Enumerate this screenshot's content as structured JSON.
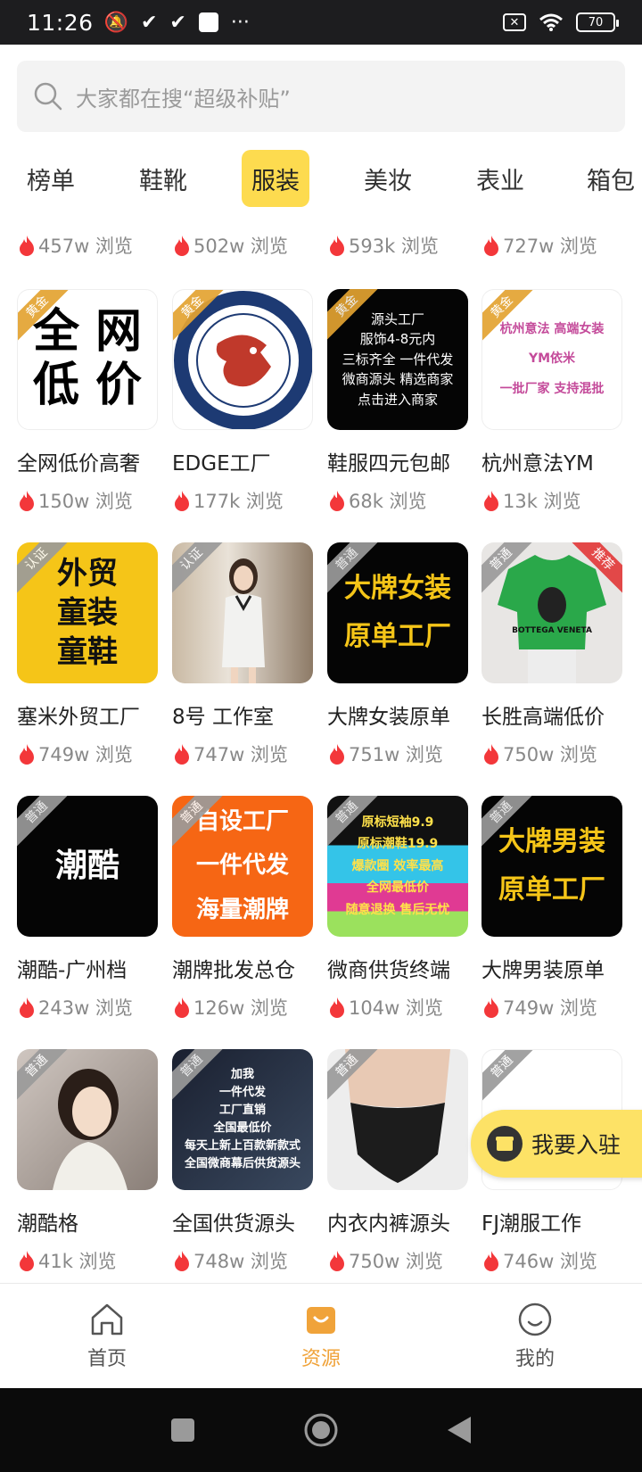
{
  "status": {
    "time": "11:26",
    "dots": "···",
    "battery": "70"
  },
  "search": {
    "placeholder": "大家都在搜“超级补贴”"
  },
  "tabs": [
    {
      "label": "榜单"
    },
    {
      "label": "鞋靴"
    },
    {
      "label": "服装"
    },
    {
      "label": "美妆"
    },
    {
      "label": "表业"
    },
    {
      "label": "箱包"
    }
  ],
  "active_tab": "服装",
  "partial_row": [
    "457w 浏览",
    "502w 浏览",
    "593k 浏览",
    "727w 浏览"
  ],
  "cards": [
    {
      "name": "全网低价高奢",
      "views": "150w 浏览",
      "badge": "黄金",
      "thumb_text": "全 网\n低 价"
    },
    {
      "name": "EDGE工厂",
      "views": "177k 浏览",
      "badge": "黄金",
      "thumb_text": "GUIMEIGONGZHU DIHU MOGUIXIONGDI"
    },
    {
      "name": "鞋服四元包邮",
      "views": "68k 浏览",
      "badge": "黄金",
      "thumb_text": "源头工厂\n服饰4-8元内\n三标齐全 一件代发\n微商源头 精选商家\n点击进入商家"
    },
    {
      "name": "杭州意法YM",
      "views": "13k 浏览",
      "badge": "黄金",
      "thumb_text": "杭州意法 高端女装\nYM依米\n一批厂家 支持混批"
    },
    {
      "name": "塞米外贸工厂",
      "views": "749w 浏览",
      "badge": "认证",
      "thumb_text": "外贸\n童装\n童鞋"
    },
    {
      "name": "8号 工作室",
      "views": "747w 浏览",
      "badge": "认证",
      "thumb_text": ""
    },
    {
      "name": "大牌女装原单",
      "views": "751w 浏览",
      "badge": "普通",
      "thumb_text": "大牌女装\n原单工厂"
    },
    {
      "name": "长胜高端低价",
      "views": "750w 浏览",
      "badge": "普通",
      "badge2": "推荐",
      "thumb_text": "BOTTEGA VENETA"
    },
    {
      "name": "潮酷-广州档",
      "views": "243w 浏览",
      "badge": "普通",
      "thumb_text": "潮酷"
    },
    {
      "name": "潮牌批发总仓",
      "views": "126w 浏览",
      "badge": "普通",
      "thumb_text": "自设工厂\n一件代发\n海量潮牌"
    },
    {
      "name": "微商供货终端",
      "views": "104w 浏览",
      "badge": "普通",
      "thumb_text": "原标短袖9.9\n原标潮鞋19.9\n爆款圈 效率最高\n全网最低价\n随意退换 售后无忧"
    },
    {
      "name": "大牌男装原单",
      "views": "749w 浏览",
      "badge": "普通",
      "thumb_text": "大牌男装\n原单工厂"
    },
    {
      "name": "潮酷格",
      "views": "41k 浏览",
      "badge": "普通",
      "thumb_text": ""
    },
    {
      "name": "全国供货源头",
      "views": "748w 浏览",
      "badge": "普通",
      "thumb_text": "加我\n一件代发\n工厂直销\n全国最低价\n每天上新上百款新款式\n全国微商幕后供货源头"
    },
    {
      "name": "内衣内裤源头",
      "views": "750w 浏览",
      "badge": "普通",
      "thumb_text": ""
    },
    {
      "name": "FJ潮服工作",
      "views": "746w 浏览",
      "badge": "普通",
      "thumb_text": ""
    }
  ],
  "float_button": {
    "label": "我要入驻"
  },
  "bottom_nav": [
    {
      "label": "首页"
    },
    {
      "label": "资源"
    },
    {
      "label": "我的"
    }
  ],
  "colors": {
    "accent": "#fddb4f",
    "nav_active": "#f0a33a",
    "flame": "#f3373a"
  }
}
